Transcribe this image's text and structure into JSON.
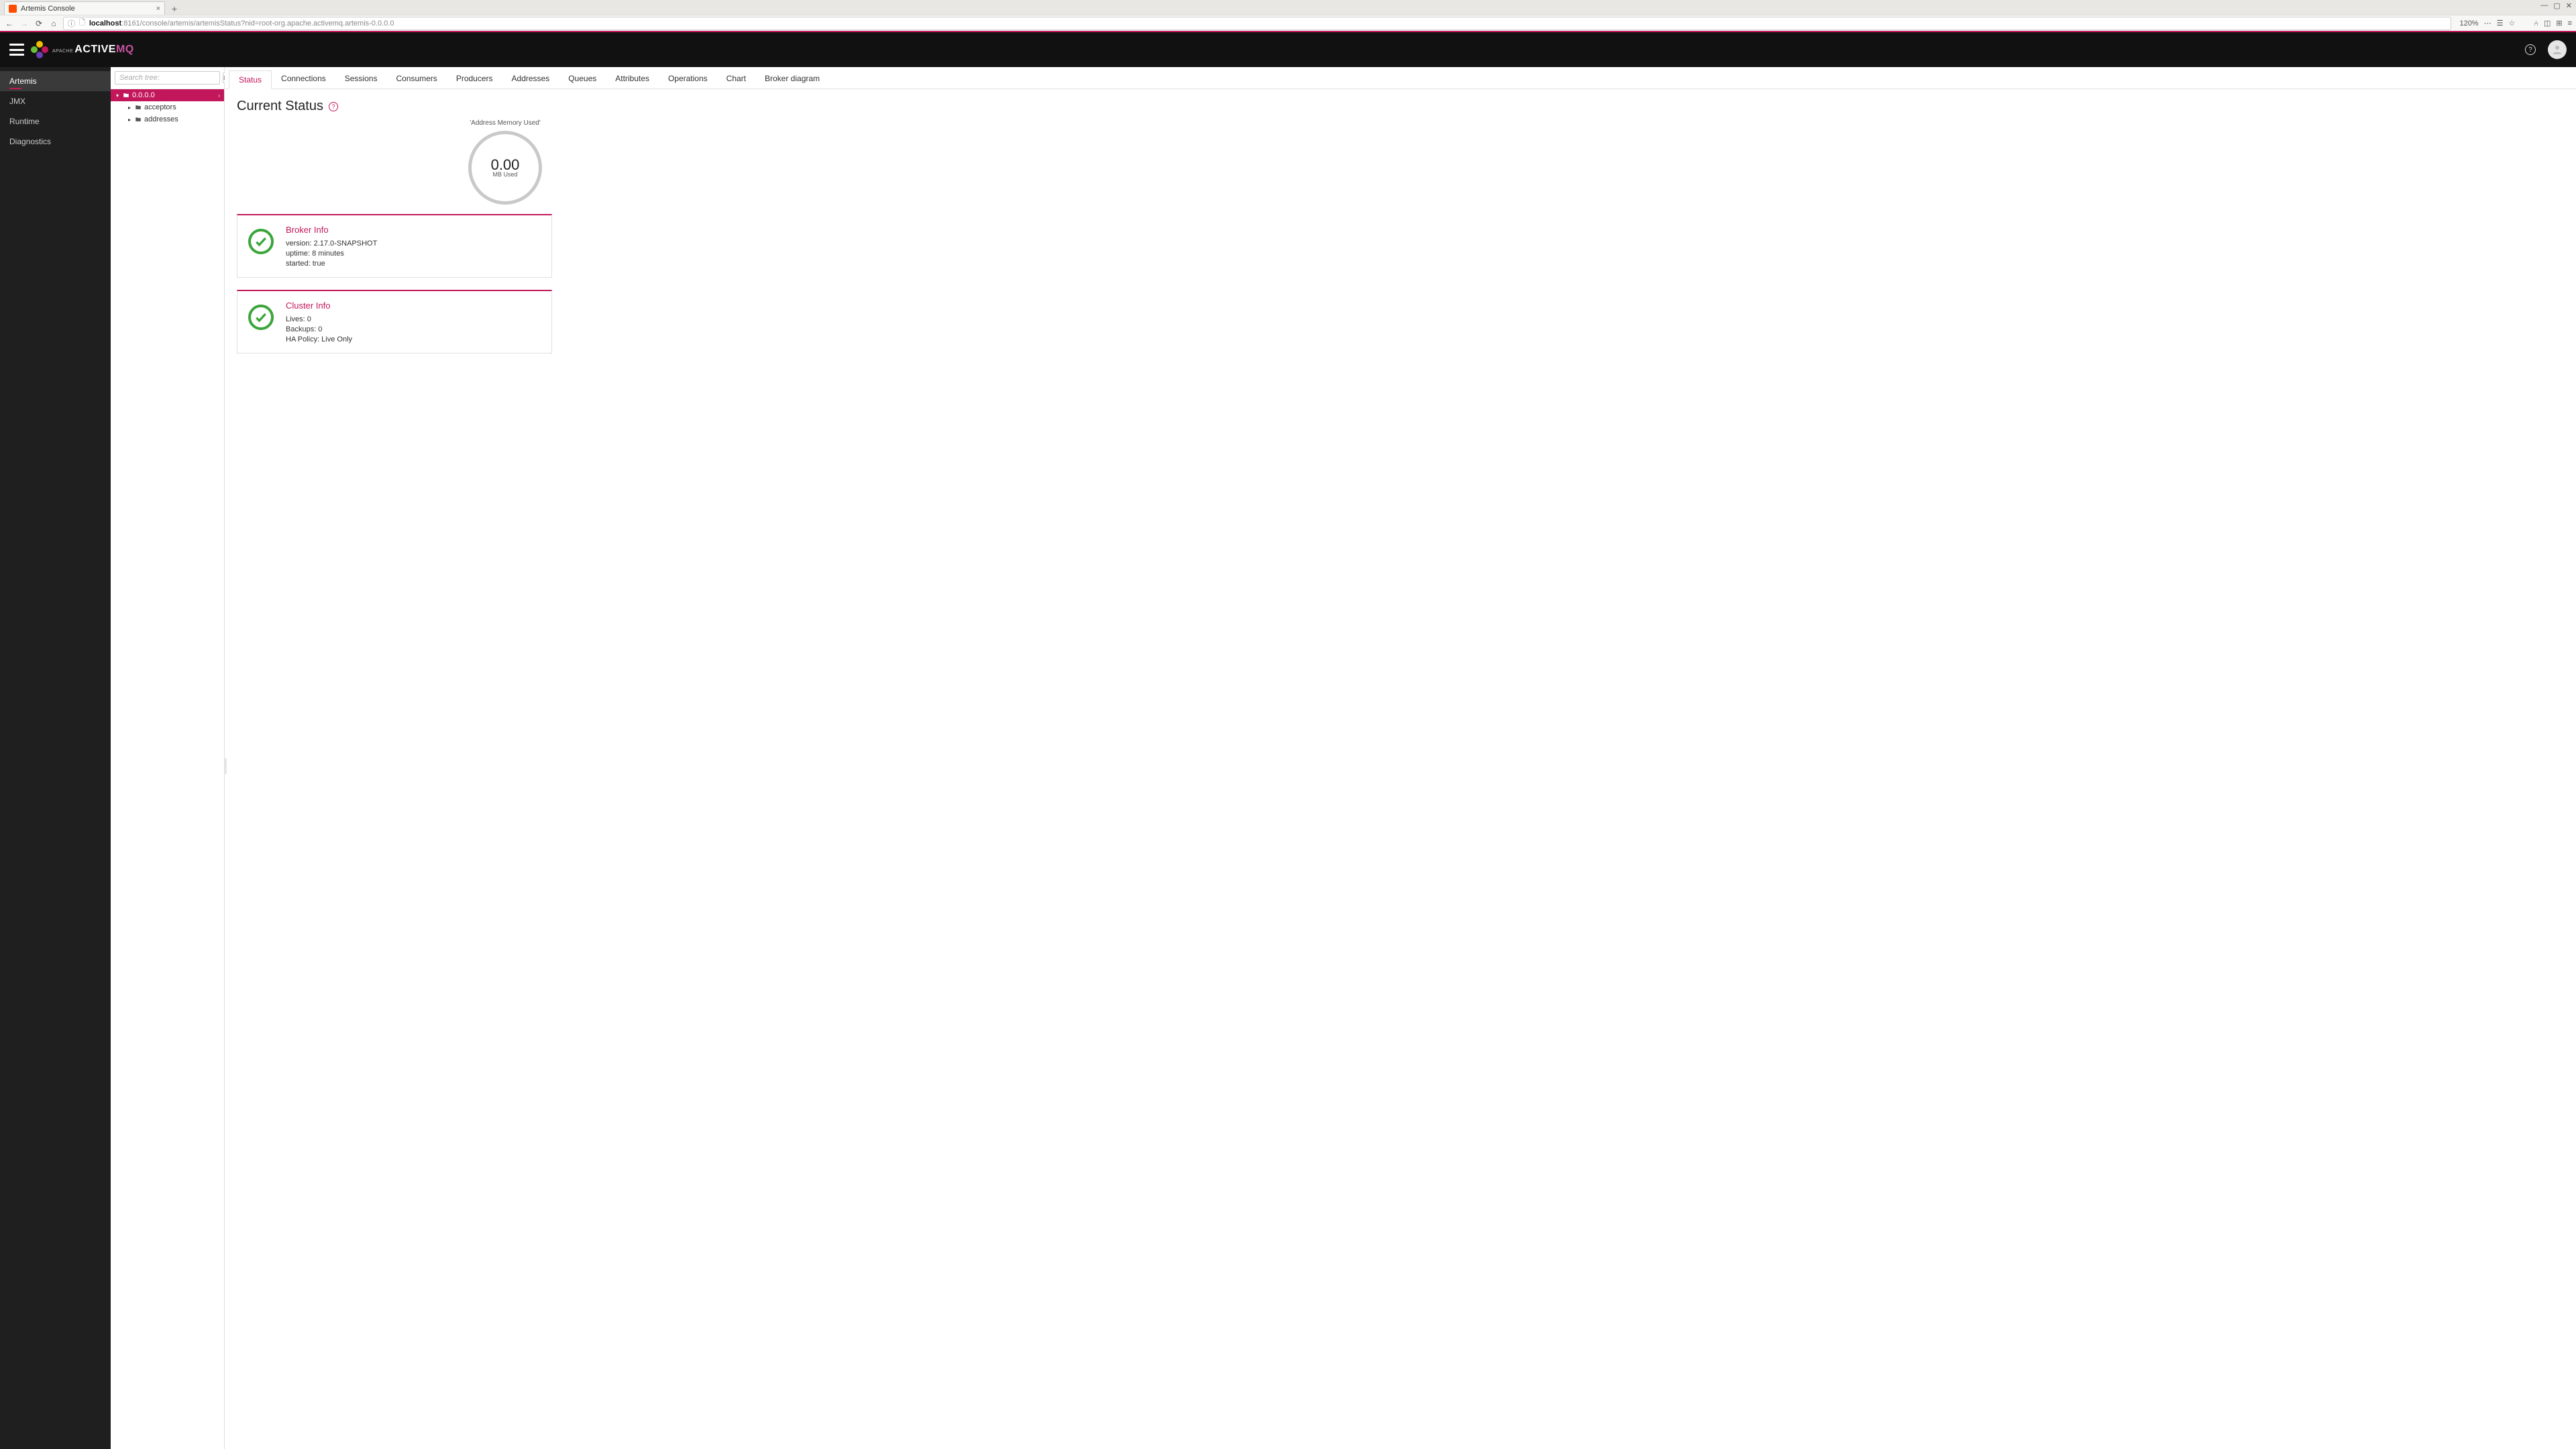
{
  "browser": {
    "tab_title": "Artemis Console",
    "zoom": "120%",
    "url_host": "localhost",
    "url_rest": ":8161/console/artemis/artemisStatus?nid=root-org.apache.activemq.artemis-0.0.0.0"
  },
  "header": {
    "logo_apache": "Apache",
    "logo_main": "ACTIVE",
    "logo_mq": "MQ"
  },
  "leftnav": {
    "items": [
      {
        "label": "Artemis",
        "active": true
      },
      {
        "label": "JMX",
        "active": false
      },
      {
        "label": "Runtime",
        "active": false
      },
      {
        "label": "Diagnostics",
        "active": false
      }
    ]
  },
  "tree": {
    "search_placeholder": "Search tree:",
    "root": "0.0.0.0",
    "children": [
      {
        "label": "acceptors"
      },
      {
        "label": "addresses"
      }
    ]
  },
  "tabs": [
    {
      "label": "Status",
      "active": true
    },
    {
      "label": "Connections"
    },
    {
      "label": "Sessions"
    },
    {
      "label": "Consumers"
    },
    {
      "label": "Producers"
    },
    {
      "label": "Addresses"
    },
    {
      "label": "Queues"
    },
    {
      "label": "Attributes"
    },
    {
      "label": "Operations"
    },
    {
      "label": "Chart"
    },
    {
      "label": "Broker diagram"
    }
  ],
  "page_title": "Current Status",
  "gauge": {
    "title": "'Address Memory Used'",
    "value": "0.00",
    "unit": "MB Used"
  },
  "broker_info": {
    "title": "Broker Info",
    "lines": {
      "version": "version: 2.17.0-SNAPSHOT",
      "uptime": "uptime: 8 minutes",
      "started": "started: true"
    }
  },
  "cluster_info": {
    "title": "Cluster Info",
    "lines": {
      "lives": "Lives: 0",
      "backups": "Backups: 0",
      "ha": "HA Policy: Live Only"
    }
  }
}
